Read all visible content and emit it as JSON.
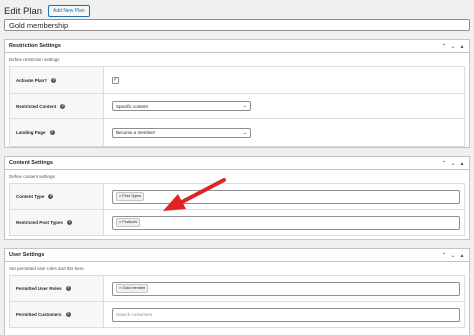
{
  "header": {
    "title": "Edit Plan",
    "add_new_label": "Add New Plan"
  },
  "plan_title": "Gold membership",
  "colors": {
    "arrow": "#e02424",
    "link": "#2271b1"
  },
  "restriction": {
    "title": "Restriction Settings",
    "description": "Define restriction settings",
    "rows": [
      {
        "label": "Activate Plan?",
        "checked": true
      },
      {
        "label": "Restricted Content",
        "value": "Specific content"
      },
      {
        "label": "Landing Page",
        "value": "Become a member!"
      }
    ]
  },
  "content": {
    "title": "Content Settings",
    "description": "Define content settings",
    "rows": [
      {
        "label": "Content Type",
        "tag": "× Post Types"
      },
      {
        "label": "Restricted Post Types",
        "tag": "× Products"
      }
    ]
  },
  "user": {
    "title": "User Settings",
    "description": "Set permitted user roles and IDs here",
    "rows": [
      {
        "label": "Permitted User Roles",
        "tag": "× Gold member"
      },
      {
        "label": "Permitted Customers",
        "placeholder": "Search customers"
      }
    ]
  },
  "icons": {
    "collapse_up": "chevron-up-icon",
    "collapse_down": "chevron-down-icon",
    "toggle": "caret-up-icon",
    "help": "help-icon",
    "check": "check-icon"
  }
}
